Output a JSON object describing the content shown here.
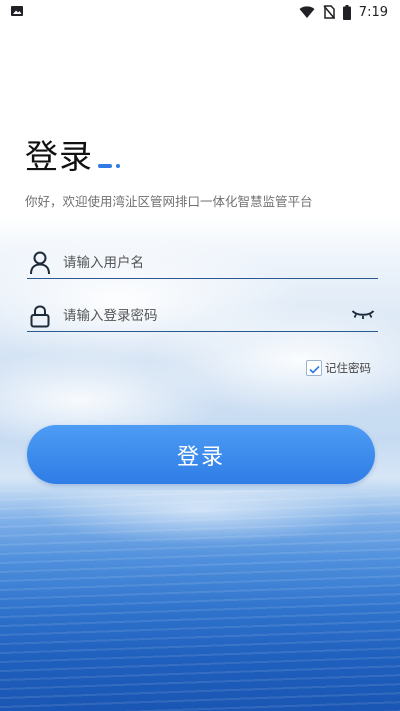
{
  "statusbar": {
    "time": "7:19",
    "icons": [
      "image-icon",
      "wifi-icon",
      "no-sim-icon",
      "battery-icon"
    ]
  },
  "login": {
    "title": "登录",
    "subtitle": "你好，欢迎使用湾沚区管网排口一体化智慧监管平台",
    "username_placeholder": "请输入用户名",
    "password_placeholder": "请输入登录密码",
    "remember_label": "记住密码",
    "remember_checked": true,
    "submit_label": "登录"
  },
  "colors": {
    "accent": "#2f7ae5",
    "button_top": "#4d9cf4",
    "button_bottom": "#2f7de6",
    "input_underline": "#2b5a93",
    "sea_dark": "#1a56b3"
  }
}
